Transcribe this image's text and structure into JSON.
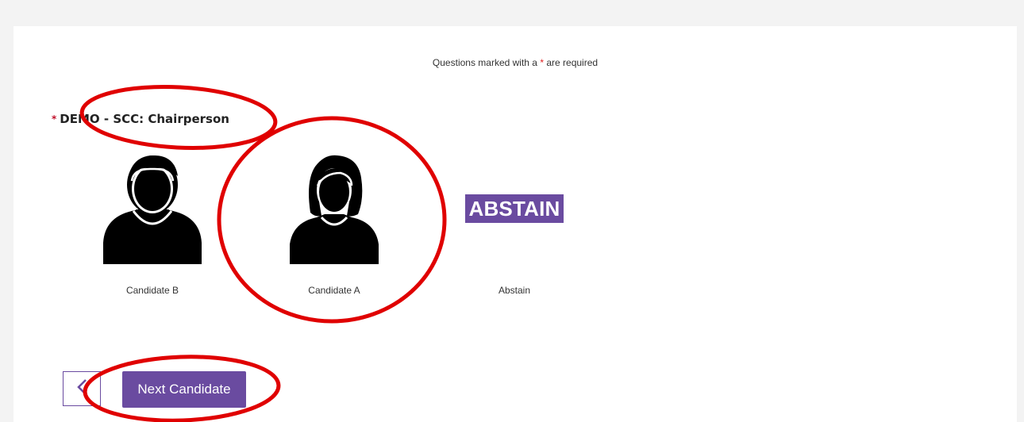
{
  "survey": {
    "required_note_prefix": "Questions marked with a",
    "required_star": "*",
    "required_note_suffix": "are required",
    "question_star": "*",
    "question_title": "DEMO - SCC: Chairperson",
    "options": [
      {
        "label": "Candidate B",
        "image": "male-avatar-icon"
      },
      {
        "label": "Candidate A",
        "image": "female-avatar-icon"
      },
      {
        "label": "Abstain",
        "badge_text": "ABSTAIN"
      }
    ]
  },
  "navigation": {
    "back_icon": "chevron-left-icon",
    "next_label": "Next Candidate"
  },
  "annotations": {
    "color": "#e00000",
    "marks": [
      "red ellipse around question title",
      "red circle around Candidate A",
      "red ellipse around Next Candidate button"
    ]
  },
  "colors": {
    "accent": "#6a4ba0",
    "required_star": "#c0102a",
    "background": "#f3f3f3"
  }
}
